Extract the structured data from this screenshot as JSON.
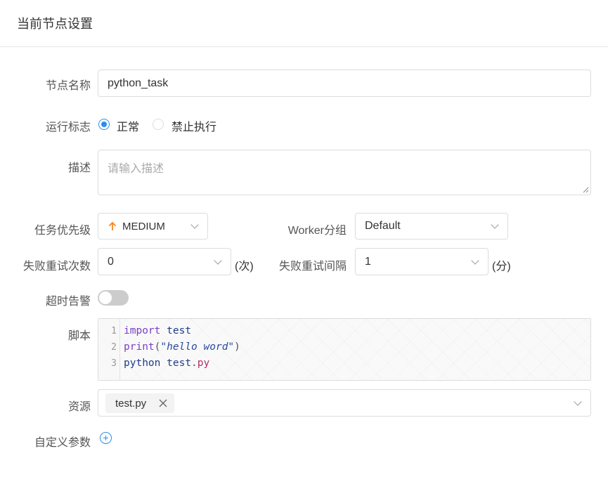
{
  "header": {
    "title": "当前节点设置"
  },
  "form": {
    "node_name": {
      "label": "节点名称",
      "value": "python_task"
    },
    "run_flag": {
      "label": "运行标志",
      "options": [
        "正常",
        "禁止执行"
      ],
      "selected": "正常"
    },
    "description": {
      "label": "描述",
      "placeholder": "请输入描述"
    },
    "priority": {
      "label": "任务优先级",
      "value": "MEDIUM",
      "icon": "arrow-up-icon",
      "icon_color": "#f5871f"
    },
    "worker_group": {
      "label": "Worker分组",
      "value": "Default"
    },
    "fail_retry_times": {
      "label": "失败重试次数",
      "value": "0",
      "suffix": "(次)"
    },
    "fail_retry_interval": {
      "label": "失败重试间隔",
      "value": "1",
      "suffix": "(分)"
    },
    "timeout_alarm": {
      "label": "超时告警",
      "enabled": false
    },
    "script": {
      "label": "脚本",
      "line_numbers": [
        "1",
        "2",
        "3"
      ],
      "lines": [
        "import test",
        "print(\"hello word\")",
        "python test.py"
      ],
      "tokens": {
        "l1_kw": "import",
        "l1_id": "test",
        "l2_fn": "print",
        "l2_open": "(",
        "l2_str": "\"hello word\"",
        "l2_close": ")",
        "l3_id1": "python",
        "l3_id2": "test",
        "l3_dot": ".",
        "l3_attr": "py"
      }
    },
    "resources": {
      "label": "资源",
      "tags": [
        "test.py"
      ]
    },
    "custom_params": {
      "label": "自定义参数",
      "icon": "add-circle-icon"
    }
  },
  "colors": {
    "accent": "#2d8cf0",
    "priority_icon": "#f5871f",
    "border": "#dcdcdc"
  }
}
